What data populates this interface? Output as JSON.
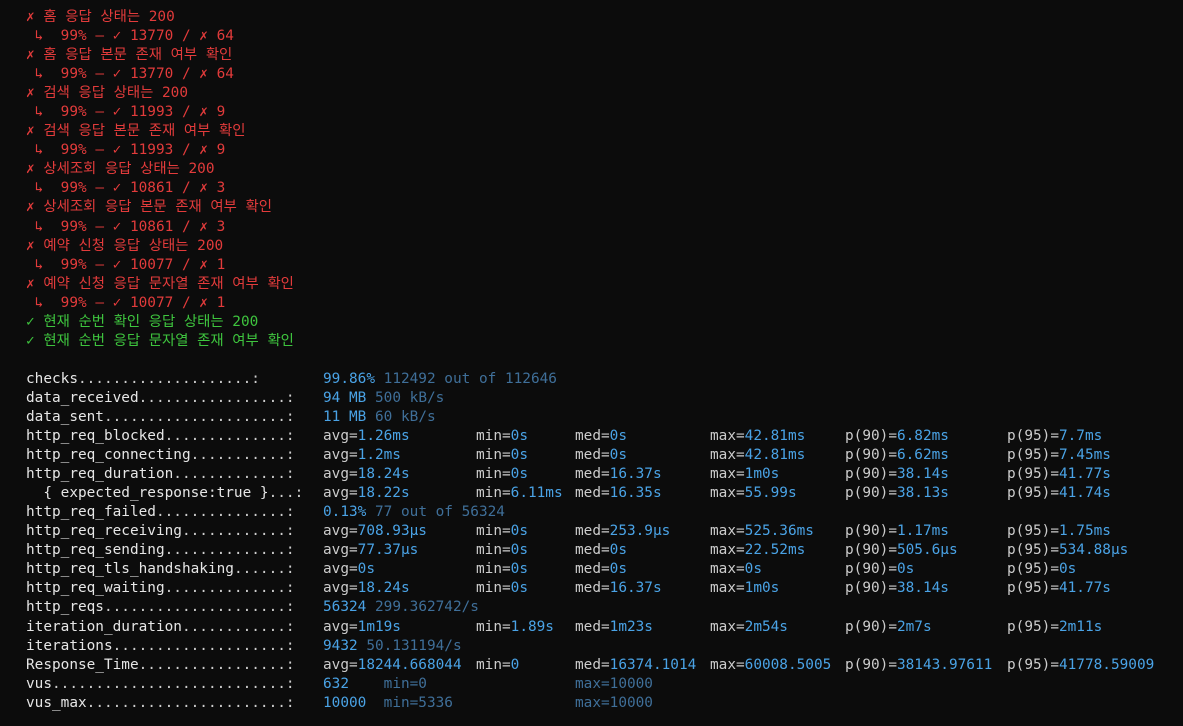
{
  "colors": {
    "background": "#0c0c0c",
    "fail": "#e23b3b",
    "pass": "#3ec43e",
    "value": "#4aa3e6",
    "secondary": "#3f6f99"
  },
  "checks_output": [
    {
      "status": "fail",
      "mark": "✗",
      "text": "홈 응답 상태는 200",
      "detail": "↳  99% — ✓ 13770 / ✗ 64"
    },
    {
      "status": "fail",
      "mark": "✗",
      "text": "홈 응답 본문 존재 여부 확인",
      "detail": "↳  99% — ✓ 13770 / ✗ 64"
    },
    {
      "status": "fail",
      "mark": "✗",
      "text": "검색 응답 상태는 200",
      "detail": "↳  99% — ✓ 11993 / ✗ 9"
    },
    {
      "status": "fail",
      "mark": "✗",
      "text": "검색 응답 본문 존재 여부 확인",
      "detail": "↳  99% — ✓ 11993 / ✗ 9"
    },
    {
      "status": "fail",
      "mark": "✗",
      "text": "상세조회 응답 상태는 200",
      "detail": "↳  99% — ✓ 10861 / ✗ 3"
    },
    {
      "status": "fail",
      "mark": "✗",
      "text": "상세조회 응답 본문 존재 여부 확인",
      "detail": "↳  99% — ✓ 10861 / ✗ 3"
    },
    {
      "status": "fail",
      "mark": "✗",
      "text": "예약 신청 응답 상태는 200",
      "detail": "↳  99% — ✓ 10077 / ✗ 1"
    },
    {
      "status": "fail",
      "mark": "✗",
      "text": "예약 신청 응답 문자열 존재 여부 확인",
      "detail": "↳  99% — ✓ 10077 / ✗ 1"
    },
    {
      "status": "pass",
      "mark": "✓",
      "text": "현재 순번 확인 응답 상태는 200",
      "detail": ""
    },
    {
      "status": "pass",
      "mark": "✓",
      "text": "현재 순번 응답 문자열 존재 여부 확인",
      "detail": ""
    }
  ],
  "metrics": [
    {
      "name": "checks",
      "dots": "....................:",
      "primary": "99.86%",
      "secondary": "112492 out of 112646"
    },
    {
      "name": "data_received",
      "dots": ".................:",
      "primary": "94 MB",
      "secondary": "500 kB/s"
    },
    {
      "name": "data_sent",
      "dots": ".....................:",
      "primary": "11 MB",
      "secondary": "60 kB/s"
    },
    {
      "name": "http_req_blocked",
      "dots": "..............:",
      "cols": [
        "avg=1.26ms",
        "min=0s",
        "med=0s",
        "max=42.81ms",
        "p(90)=6.82ms",
        "p(95)=7.7ms"
      ]
    },
    {
      "name": "http_req_connecting",
      "dots": "...........:",
      "cols": [
        "avg=1.2ms",
        "min=0s",
        "med=0s",
        "max=42.81ms",
        "p(90)=6.62ms",
        "p(95)=7.45ms"
      ]
    },
    {
      "name": "http_req_duration",
      "dots": ".............:",
      "cols": [
        "avg=18.24s",
        "min=0s",
        "med=16.37s",
        "max=1m0s",
        "p(90)=38.14s",
        "p(95)=41.77s"
      ]
    },
    {
      "name": "  { expected_response:true }",
      "dots": "...:",
      "cols": [
        "avg=18.22s",
        "min=6.11ms",
        "med=16.35s",
        "max=55.99s",
        "p(90)=38.13s",
        "p(95)=41.74s"
      ]
    },
    {
      "name": "http_req_failed",
      "dots": "...............:",
      "primary": "0.13%",
      "secondary": "77 out of 56324"
    },
    {
      "name": "http_req_receiving",
      "dots": "............:",
      "cols": [
        "avg=708.93µs",
        "min=0s",
        "med=253.9µs",
        "max=525.36ms",
        "p(90)=1.17ms",
        "p(95)=1.75ms"
      ]
    },
    {
      "name": "http_req_sending",
      "dots": "..............:",
      "cols": [
        "avg=77.37µs",
        "min=0s",
        "med=0s",
        "max=22.52ms",
        "p(90)=505.6µs",
        "p(95)=534.88µs"
      ]
    },
    {
      "name": "http_req_tls_handshaking",
      "dots": "......:",
      "cols": [
        "avg=0s",
        "min=0s",
        "med=0s",
        "max=0s",
        "p(90)=0s",
        "p(95)=0s"
      ]
    },
    {
      "name": "http_req_waiting",
      "dots": "..............:",
      "cols": [
        "avg=18.24s",
        "min=0s",
        "med=16.37s",
        "max=1m0s",
        "p(90)=38.14s",
        "p(95)=41.77s"
      ]
    },
    {
      "name": "http_reqs",
      "dots": ".....................:",
      "primary": "56324",
      "secondary": "299.362742/s"
    },
    {
      "name": "iteration_duration",
      "dots": "............:",
      "cols": [
        "avg=1m19s",
        "min=1.89s",
        "med=1m23s",
        "max=2m54s",
        "p(90)=2m7s",
        "p(95)=2m11s"
      ]
    },
    {
      "name": "iterations",
      "dots": "....................:",
      "primary": "9432",
      "secondary": "50.131194/s"
    },
    {
      "name": "Response_Time",
      "dots": ".................:",
      "cols": [
        "avg=18244.668044",
        "min=0",
        "med=16374.1014",
        "max=60008.5005",
        "p(90)=38143.97611",
        "p(95)=41778.59009"
      ]
    },
    {
      "name": "vus",
      "dots": "...........................:",
      "primary": "632",
      "secondary": "min=0",
      "tertiary": "max=10000"
    },
    {
      "name": "vus_max",
      "dots": ".......................:",
      "primary": "10000",
      "secondary": "min=5336",
      "tertiary": "max=10000"
    }
  ]
}
